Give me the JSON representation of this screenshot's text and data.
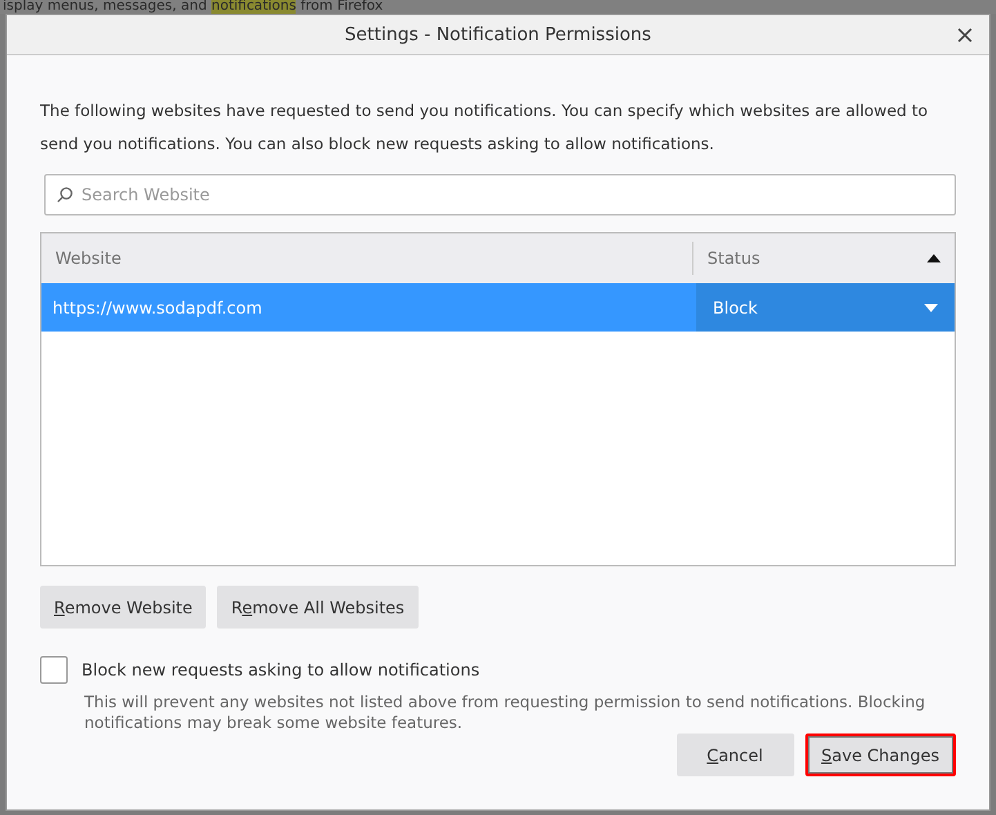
{
  "backdrop": {
    "before": "isplay menus, messages, and ",
    "highlight": "notifications",
    "after": " from Firefox"
  },
  "window": {
    "title": "Settings - Notification Permissions"
  },
  "intro": "The following websites have requested to send you notifications. You can specify which websites are allowed to send you notifications. You can also block new requests asking to allow notifications.",
  "search": {
    "placeholder": "Search Website"
  },
  "table": {
    "columns": [
      {
        "label": "Website",
        "sorted": false
      },
      {
        "label": "Status",
        "sorted": true
      }
    ],
    "rows": [
      {
        "website": "https://www.sodapdf.com",
        "status": "Block",
        "selected": true
      }
    ]
  },
  "list_buttons": [
    {
      "accesskey": "R",
      "label_end": "emove Website"
    },
    {
      "label_start": "R",
      "accesskey": "e",
      "label_end": "move All Websites"
    }
  ],
  "block_option": {
    "label": "Block new requests asking to allow notifications",
    "checked": false,
    "description": "This will prevent any websites not listed above from requesting permission to send notifications. Blocking notifications may break some website features."
  },
  "footer_buttons": [
    {
      "accesskey": "C",
      "label_end": "ancel",
      "focused": false
    },
    {
      "accesskey": "S",
      "label_end": "ave Changes",
      "focused": true
    }
  ]
}
